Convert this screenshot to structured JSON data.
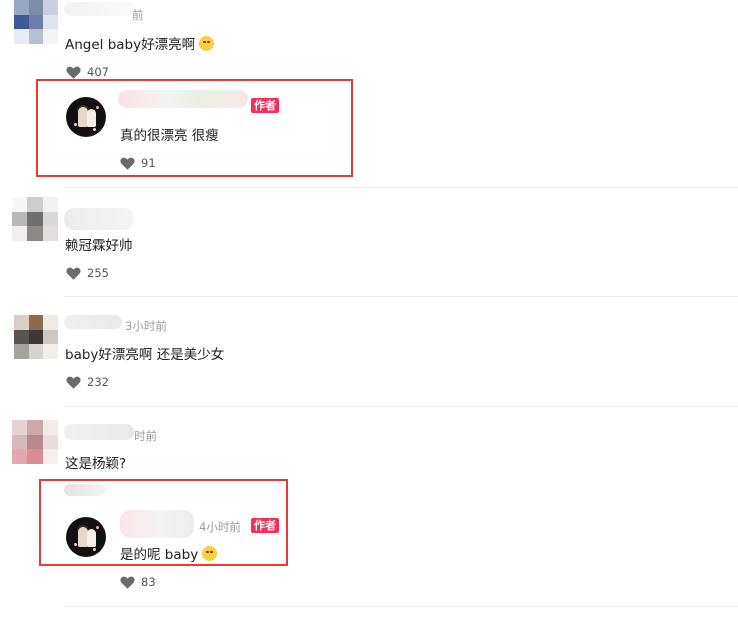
{
  "comments": [
    {
      "time_suffix": "前",
      "text": "Angel baby好漂亮啊",
      "emoji": "blushing-face",
      "likes": "407",
      "reply": {
        "text": "真的很漂亮 很瘦",
        "likes": "91",
        "badge": "作者"
      }
    },
    {
      "text": "赖冠霖好帅",
      "likes": "255"
    },
    {
      "time": "3小时前",
      "text": "baby好漂亮啊 还是美少女",
      "likes": "232"
    },
    {
      "time_suffix": "时前",
      "text": "这是杨颖?",
      "likes": "",
      "reply": {
        "time": "4小时前",
        "badge": "作者",
        "text": "是的呢 baby",
        "emoji": "grinning-face",
        "likes": "83"
      }
    }
  ],
  "colors": {
    "author_badge": "#fe2c55",
    "highlight": "#e8393b",
    "meta": "#9a9a9a"
  },
  "icons": {
    "like": "heart-icon"
  }
}
